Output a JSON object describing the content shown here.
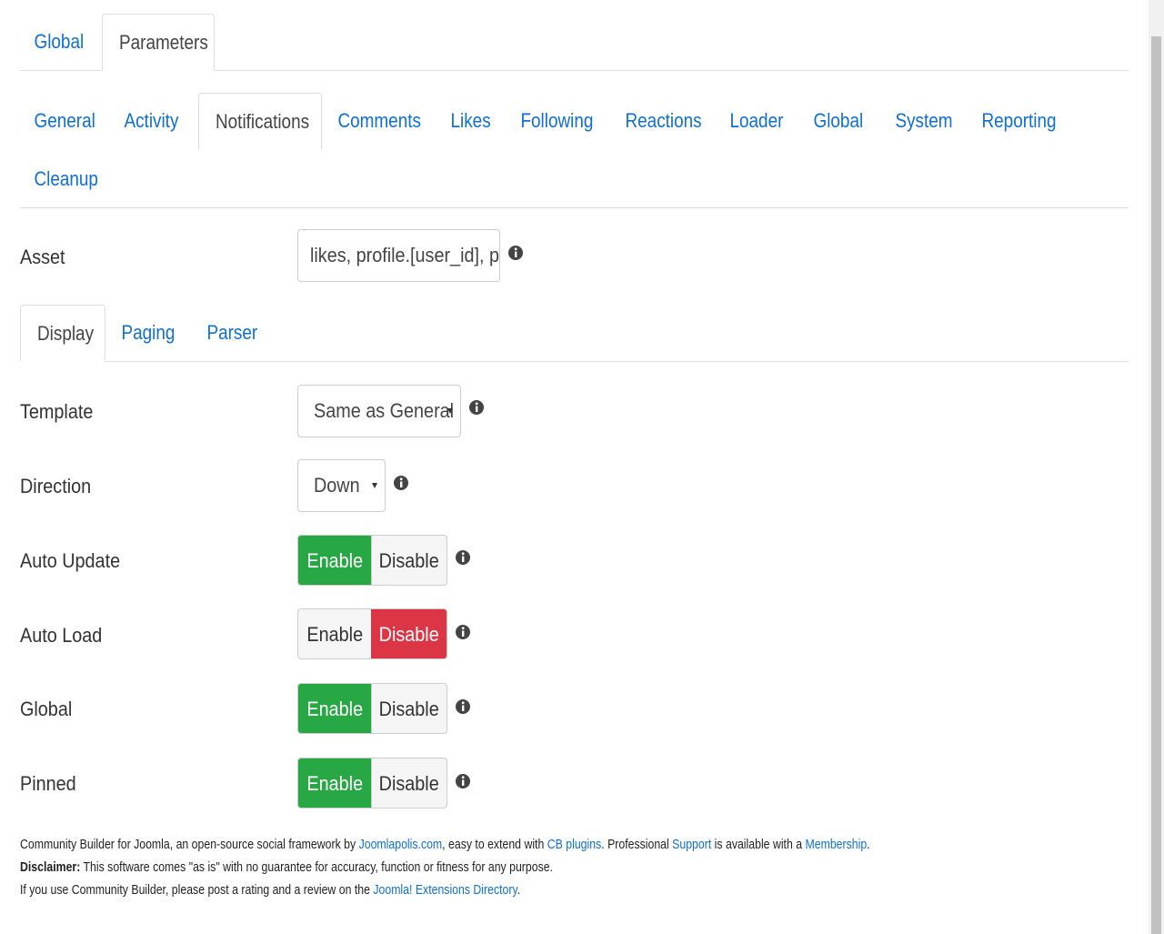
{
  "top_tabs": [
    {
      "label": "Global"
    },
    {
      "label": "Parameters"
    }
  ],
  "sub_tabs": [
    {
      "label": "General"
    },
    {
      "label": "Activity"
    },
    {
      "label": "Notifications"
    },
    {
      "label": "Comments"
    },
    {
      "label": "Likes"
    },
    {
      "label": "Following"
    },
    {
      "label": "Reactions"
    },
    {
      "label": "Loader"
    },
    {
      "label": "Global"
    },
    {
      "label": "System"
    },
    {
      "label": "Reporting"
    },
    {
      "label": "Cleanup"
    }
  ],
  "asset": {
    "label": "Asset",
    "value": "likes, profile.[user_id], prc"
  },
  "inner_tabs": [
    {
      "label": "Display"
    },
    {
      "label": "Paging"
    },
    {
      "label": "Parser"
    }
  ],
  "template": {
    "label": "Template",
    "value": "Same as General"
  },
  "direction": {
    "label": "Direction",
    "value": "Down"
  },
  "toggles": [
    {
      "label": "Auto Update",
      "enable": "Enable",
      "disable": "Disable",
      "state": "enable"
    },
    {
      "label": "Auto Load",
      "enable": "Enable",
      "disable": "Disable",
      "state": "disable"
    },
    {
      "label": "Global",
      "enable": "Enable",
      "disable": "Disable",
      "state": "enable"
    },
    {
      "label": "Pinned",
      "enable": "Enable",
      "disable": "Disable",
      "state": "enable"
    }
  ],
  "footer": {
    "line1_a": "Community Builder for Joomla, an open-source social framework by ",
    "link_joomlapolis": "Joomlapolis.com",
    "line1_b": ", easy to extend with ",
    "link_cb_plugins": "CB plugins",
    "line1_c": ". Professional ",
    "link_support": "Support",
    "line1_d": " is available with a ",
    "link_membership": "Membership",
    "line1_e": ".",
    "disclaimer_label": "Disclaimer:",
    "disclaimer_text": " This software comes \"as is\" with no guarantee for accuracy, function or fitness for any purpose.",
    "line3_a": "If you use Community Builder, please post a rating and a review on the ",
    "link_jed": "Joomla! Extensions Directory",
    "line3_b": "."
  },
  "colors": {
    "link": "#0f6fd6",
    "enable_active": "#28a745",
    "disable_active": "#dc3545"
  }
}
